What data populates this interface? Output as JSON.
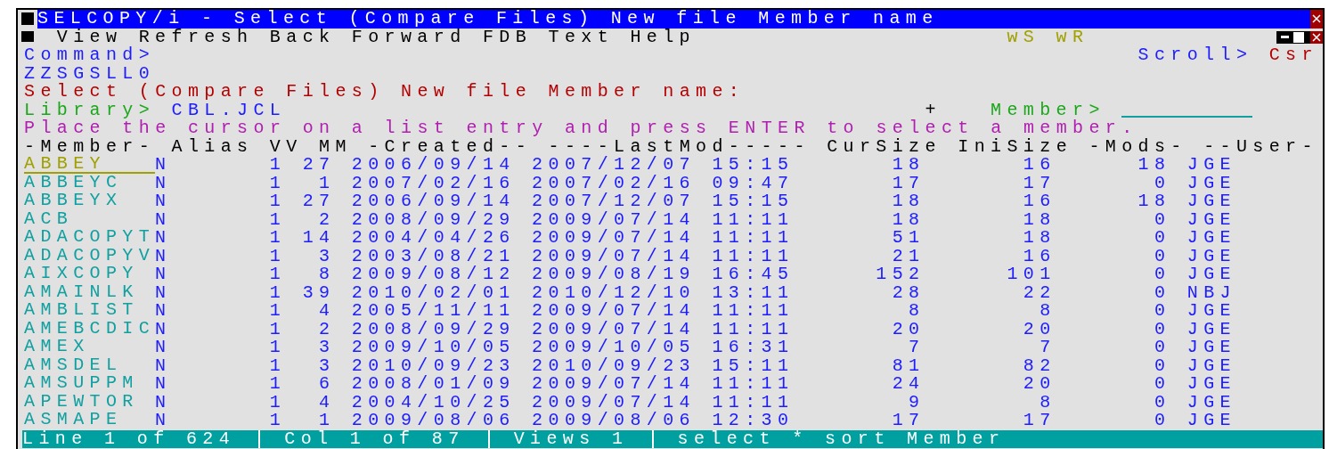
{
  "window": {
    "title": "SELCOPY/i - Select (Compare Files) New file Member name"
  },
  "menu": [
    "View",
    "Refresh",
    "Back",
    "Forward",
    "FDB",
    "Text",
    "Help"
  ],
  "indicators": [
    "wS",
    "wR"
  ],
  "command": {
    "label": "Command>"
  },
  "scroll": {
    "label": "Scroll>",
    "value": "Csr"
  },
  "dataset": "ZZSGSLL0",
  "heading": "Select (Compare Files) New file Member name:",
  "library": {
    "label": "Library>",
    "value": "CBL.JCL"
  },
  "plus": "+",
  "member_field": {
    "label": "Member>"
  },
  "instruction": "Place the cursor on a list entry and press ENTER to select a member.",
  "table": {
    "columns": [
      "-Member-",
      "Alias",
      "VV",
      "MM",
      "-Created--",
      "----LastMod-----",
      "CurSize",
      "IniSize",
      "-Mods-",
      "--User-"
    ],
    "rows": [
      {
        "selected": true,
        "cells": [
          "ABBEY",
          "N",
          "1",
          "27",
          "2006/09/14",
          "2007/12/07 15:15",
          "18",
          "16",
          "18",
          "JGE"
        ]
      },
      {
        "selected": false,
        "cells": [
          "ABBEYC",
          "N",
          "1",
          "1",
          "2007/02/16",
          "2007/02/16 09:47",
          "17",
          "17",
          "0",
          "JGE"
        ]
      },
      {
        "selected": false,
        "cells": [
          "ABBEYX",
          "N",
          "1",
          "27",
          "2006/09/14",
          "2007/12/07 15:15",
          "18",
          "16",
          "18",
          "JGE"
        ]
      },
      {
        "selected": false,
        "cells": [
          "ACB",
          "N",
          "1",
          "2",
          "2008/09/29",
          "2009/07/14 11:11",
          "18",
          "18",
          "0",
          "JGE"
        ]
      },
      {
        "selected": false,
        "cells": [
          "ADACOPYT",
          "N",
          "1",
          "14",
          "2004/04/26",
          "2009/07/14 11:11",
          "51",
          "18",
          "0",
          "JGE"
        ]
      },
      {
        "selected": false,
        "cells": [
          "ADACOPYV",
          "N",
          "1",
          "3",
          "2003/08/21",
          "2009/07/14 11:11",
          "21",
          "16",
          "0",
          "JGE"
        ]
      },
      {
        "selected": false,
        "cells": [
          "AIXCOPY",
          "N",
          "1",
          "8",
          "2009/08/12",
          "2009/08/19 16:45",
          "152",
          "101",
          "0",
          "JGE"
        ]
      },
      {
        "selected": false,
        "cells": [
          "AMAINLK",
          "N",
          "1",
          "39",
          "2010/02/01",
          "2010/12/10 13:11",
          "28",
          "22",
          "0",
          "NBJ"
        ]
      },
      {
        "selected": false,
        "cells": [
          "AMBLIST",
          "N",
          "1",
          "4",
          "2005/11/11",
          "2009/07/14 11:11",
          "8",
          "8",
          "0",
          "JGE"
        ]
      },
      {
        "selected": false,
        "cells": [
          "AMEBCDIC",
          "N",
          "1",
          "2",
          "2008/09/29",
          "2009/07/14 11:11",
          "20",
          "20",
          "0",
          "JGE"
        ]
      },
      {
        "selected": false,
        "cells": [
          "AMEX",
          "N",
          "1",
          "3",
          "2009/10/05",
          "2009/10/05 16:31",
          "7",
          "7",
          "0",
          "JGE"
        ]
      },
      {
        "selected": false,
        "cells": [
          "AMSDEL",
          "N",
          "1",
          "3",
          "2010/09/23",
          "2010/09/23 15:11",
          "81",
          "82",
          "0",
          "JGE"
        ]
      },
      {
        "selected": false,
        "cells": [
          "AMSUPPM",
          "N",
          "1",
          "6",
          "2008/01/09",
          "2009/07/14 11:11",
          "24",
          "20",
          "0",
          "JGE"
        ]
      },
      {
        "selected": false,
        "cells": [
          "APEWTOR",
          "N",
          "1",
          "4",
          "2004/10/25",
          "2009/07/14 11:11",
          "9",
          "8",
          "0",
          "JGE"
        ]
      },
      {
        "selected": false,
        "cells": [
          "ASMAPE",
          "N",
          "1",
          "1",
          "2009/08/06",
          "2009/08/06 12:30",
          "17",
          "17",
          "0",
          "JGE"
        ]
      }
    ]
  },
  "status_bar": [
    "Line 1 of 624",
    "Col 1 of 87",
    "Views 1",
    "select * sort Member"
  ]
}
